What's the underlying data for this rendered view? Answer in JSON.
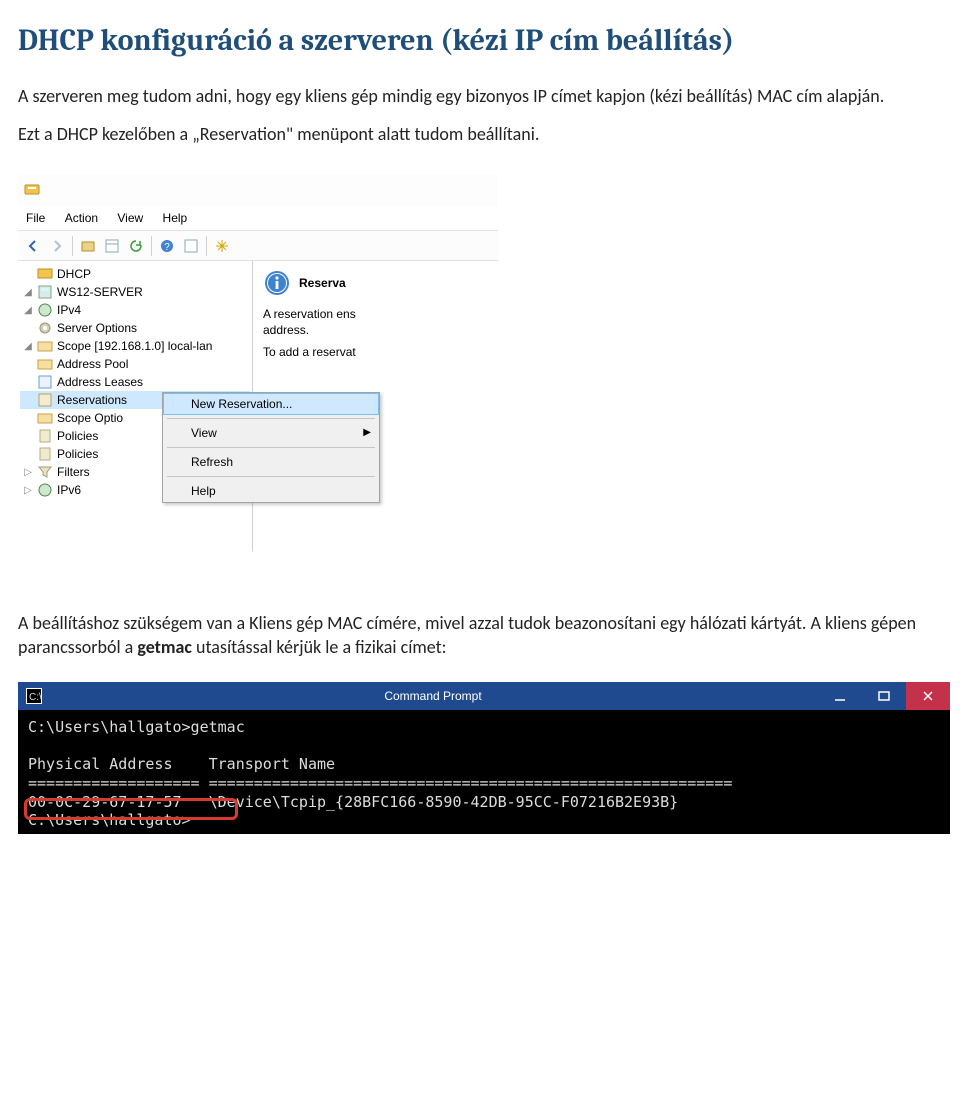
{
  "heading": "DHCP konfiguráció a szerveren (kézi IP cím beállítás)",
  "intro_p1": "A szerveren meg tudom adni, hogy egy kliens gép mindig egy bizonyos IP címet kapjon (kézi beállítás) MAC cím alapján.",
  "intro_p2": "Ezt a DHCP kezelőben a „Reservation\" menüpont alatt tudom beállítani.",
  "dhcp_window": {
    "menubar": {
      "file": "File",
      "action": "Action",
      "view": "View",
      "help": "Help"
    },
    "tree": {
      "root": "DHCP",
      "server": "WS12-SERVER",
      "ipv4": "IPv4",
      "server_options": "Server Options",
      "scope": "Scope [192.168.1.0] local-lan",
      "address_pool": "Address Pool",
      "address_leases": "Address Leases",
      "reservations": "Reservations",
      "scope_optio": "Scope Optio",
      "policies1": "Policies",
      "policies2": "Policies",
      "filters": "Filters",
      "ipv6": "IPv6"
    },
    "right": {
      "title": "Reserva",
      "line1": "A reservation ens",
      "line2": "address.",
      "line3": "To add a reservat"
    },
    "context_menu": {
      "new_reservation": "New Reservation...",
      "view": "View",
      "refresh": "Refresh",
      "help": "Help"
    }
  },
  "outro_p1_a": "A beállításhoz szükségem van a Kliens gép MAC címére, mivel azzal tudok beazonosítani egy hálózati kártyát. A kliens gépen parancssorból a ",
  "outro_p1_bold": "getmac",
  "outro_p1_b": " utasítással kérjük le a fizikai címet:",
  "cmd": {
    "title": "Command Prompt",
    "line1": "C:\\Users\\hallgato>getmac",
    "line2": "",
    "line3": "Physical Address    Transport Name",
    "line4": "=================== ==========================================================",
    "line5": "00-0C-29-67-17-57   \\Device\\Tcpip_{28BFC166-8590-42DB-95CC-F07216B2E93B}",
    "line6": "C:\\Users\\hallgato>"
  }
}
